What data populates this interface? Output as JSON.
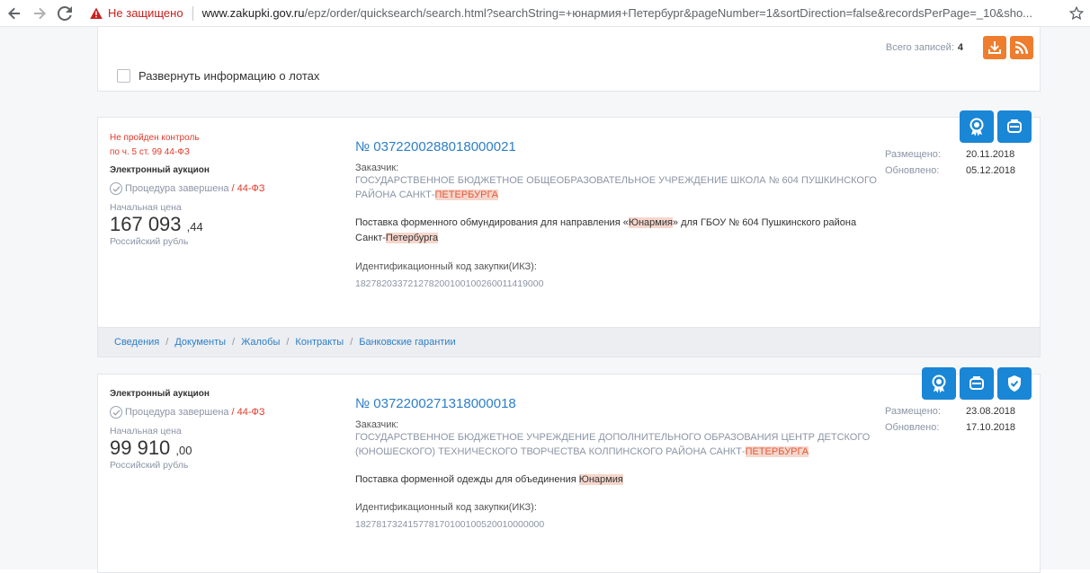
{
  "browser": {
    "not_secure_label": "Не защищено",
    "url_host": "www.zakupki.gov.ru",
    "url_path": "/epz/order/quicksearch/search.html?searchString=+юнармия+Петербург&pageNumber=1&sortDirection=false&recordsPerPage=_10&sho..."
  },
  "header": {
    "total_label": "Всего записей:",
    "total_value": "4",
    "expand_label": "Развернуть информацию о лотах"
  },
  "records": [
    {
      "warning_line1": "Не пройден контроль",
      "warning_line2": "по ч. 5 ст. 99 44-ФЗ",
      "type": "Электронный аукцион",
      "status": "Процедура завершена",
      "status_sep": "/",
      "law": "44-ФЗ",
      "price_label": "Начальная цена",
      "price_main": "167 093",
      "price_cents": ",44",
      "currency": "Российский рубль",
      "number": "№ 0372200288018000021",
      "customer_label": "Заказчик:",
      "customer_line1": "ГОСУДАРСТВЕННОЕ БЮДЖЕТНОЕ ОБЩЕОБРАЗОВАТЕЛЬНОЕ УЧРЕЖДЕНИЕ ШКОЛА № 604 ПУШКИНСКОГО",
      "customer_line2_a": "РАЙОНА САНКТ-",
      "customer_line2_hl": "ПЕТЕРБУРГА",
      "desc_a": "Поставка форменного обмундирования для направления «",
      "desc_hl1": "Юнармия",
      "desc_b": "» для ГБОУ № 604 Пушкинского района",
      "desc_c": "Санкт-",
      "desc_hl2": "Петербурга",
      "ikz_label": "Идентификационный код закупки(ИКЗ):",
      "ikz_value": "182782033721278200100100260011419000",
      "placed_label": "Размещено:",
      "placed_value": "20.11.2018",
      "updated_label": "Обновлено:",
      "updated_value": "05.12.2018",
      "tabs": [
        "Сведения",
        "Документы",
        "Жалобы",
        "Контракты",
        "Банковские гарантии"
      ]
    },
    {
      "type": "Электронный аукцион",
      "status": "Процедура завершена",
      "status_sep": "/",
      "law": "44-ФЗ",
      "price_label": "Начальная цена",
      "price_main": "99 910",
      "price_cents": ",00",
      "currency": "Российский рубль",
      "number": "№ 0372200271318000018",
      "customer_label": "Заказчик:",
      "customer_line1": "ГОСУДАРСТВЕННОЕ БЮДЖЕТНОЕ УЧРЕЖДЕНИЕ ДОПОЛНИТЕЛЬНОГО ОБРАЗОВАНИЯ ЦЕНТР ДЕТСКОГО",
      "customer_line2_a": "(ЮНОШЕСКОГО) ТЕХНИЧЕСКОГО ТВОРЧЕСТВА КОЛПИНСКОГО РАЙОНА САНКТ-",
      "customer_line2_hl": "ПЕТЕРБУРГА",
      "desc_a": "Поставка форменной одежды для объединения ",
      "desc_hl1": "Юнармия",
      "ikz_label": "Идентификационный код закупки(ИКЗ):",
      "ikz_value": "182781732415778170100100520010000000",
      "placed_label": "Размещено:",
      "placed_value": "23.08.2018",
      "updated_label": "Обновлено:",
      "updated_value": "17.10.2018"
    }
  ],
  "colors": {
    "accent_blue": "#1a86d6",
    "link_blue": "#2d7ec8",
    "orange": "#ee7d2e",
    "warning_red": "#e03a2a",
    "highlight_bg": "#f6d6cc"
  }
}
